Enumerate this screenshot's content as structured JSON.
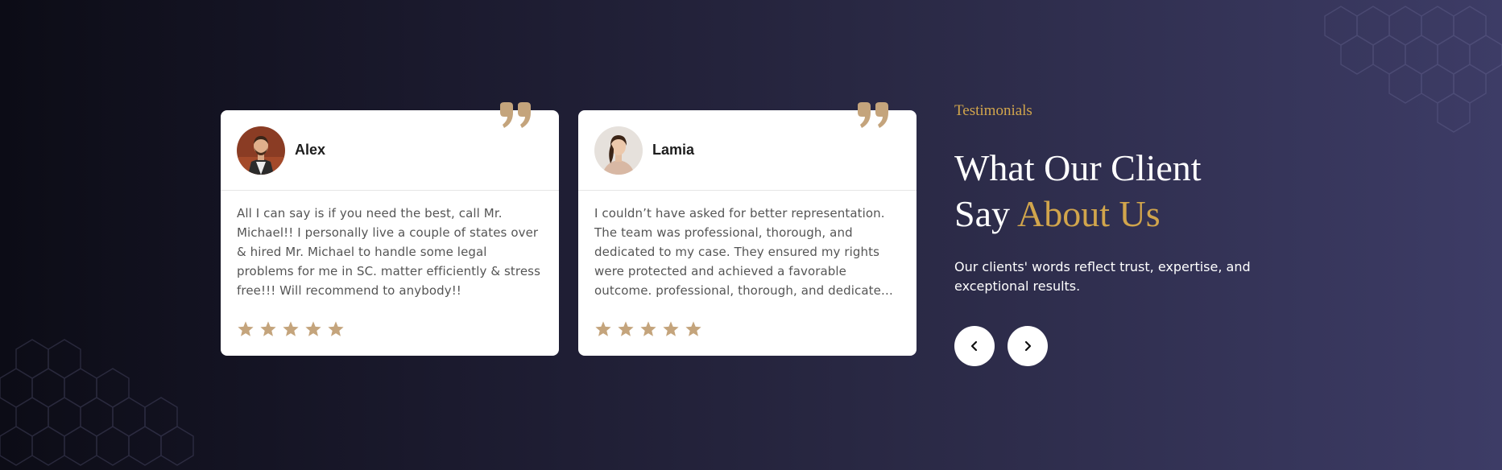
{
  "section": {
    "label": "Testimonials",
    "title_line1": "What Our Client",
    "title_line2_prefix": "Say",
    "title_line2_accent": "About Us",
    "description": "Our clients' words reflect trust, expertise, and exceptional results."
  },
  "testimonials": [
    {
      "name": "Alex",
      "text": "All I can say is if you need the best, call Mr. Michael!! I personally live a couple of states over & hired Mr. Michael to handle some legal problems for me in SC. matter efficiently & stress free!!! Will recommend to anybody!!",
      "rating": 5
    },
    {
      "name": "Lamia",
      "text": "I couldn’t have asked for better representation. The team was professional, thorough, and dedicated to my case. They ensured my rights were protected and achieved a favorable outcome. professional, thorough, and dedicate…",
      "rating": 5
    }
  ],
  "colors": {
    "accent": "#d1a54c",
    "star": "#c4a47c",
    "quote": "#c4a47c"
  },
  "icons": {
    "prev": "chevron-left-icon",
    "next": "chevron-right-icon",
    "quote": "quote-icon",
    "star": "star-icon"
  }
}
